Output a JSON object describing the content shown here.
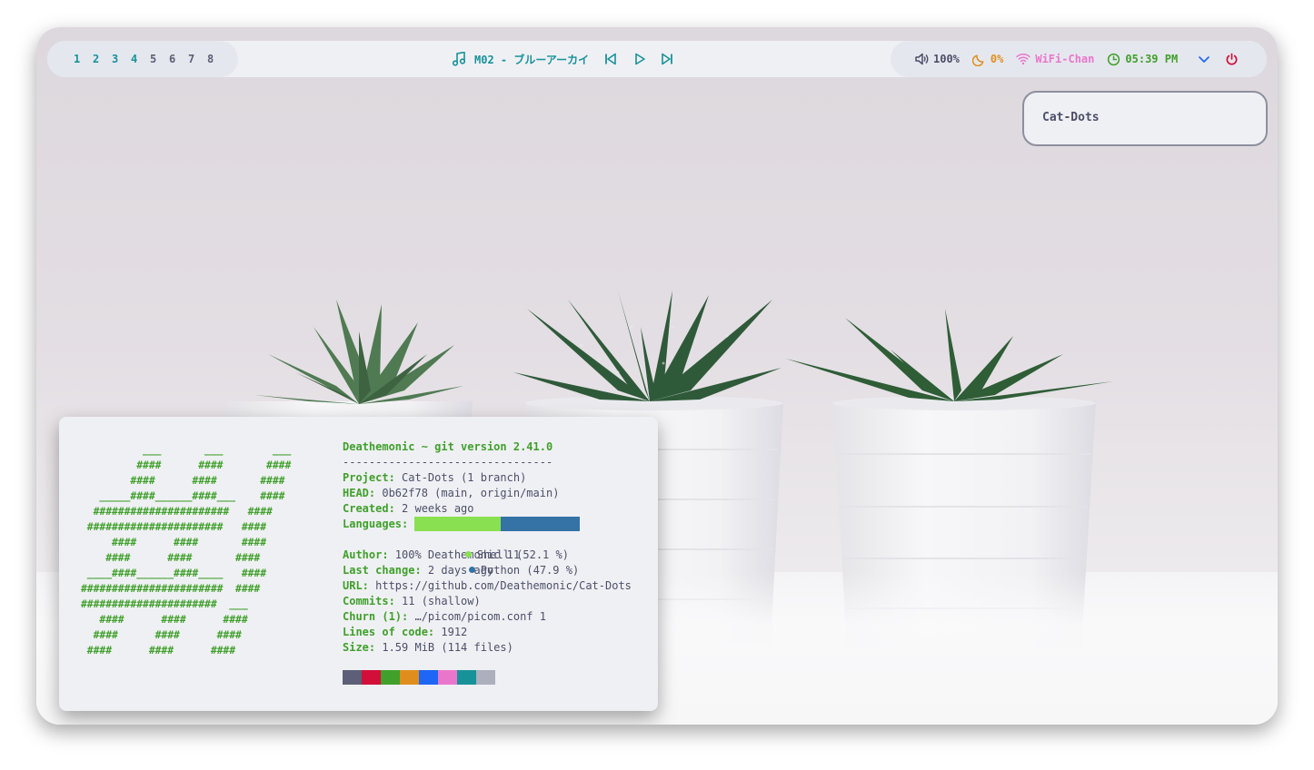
{
  "workspaces": {
    "items": [
      "1",
      "2",
      "3",
      "4",
      "5",
      "6",
      "7",
      "8"
    ],
    "active": [
      0,
      1,
      2,
      3
    ]
  },
  "media": {
    "title": "M02 - ブルーアーカイ",
    "note_icon": "music-note-icon",
    "prev_icon": "skip-back-icon",
    "play_icon": "play-icon",
    "next_icon": "skip-forward-icon",
    "color": "#179299"
  },
  "status": {
    "volume": {
      "icon": "volume-icon",
      "value": "100%",
      "color": "#4c4f69"
    },
    "brightness": {
      "icon": "moon-icon",
      "value": "0%",
      "color": "#df8e1d"
    },
    "wifi": {
      "icon": "wifi-icon",
      "value": "WiFi-Chan",
      "color": "#ea76cb"
    },
    "clock": {
      "icon": "clock-icon",
      "value": "05:39 PM",
      "color": "#40a02b"
    },
    "tray_icon": "chevron-down-icon",
    "power_icon": "power-icon",
    "power_color": "#d20f39"
  },
  "notification": {
    "text": "Cat-Dots"
  },
  "terminal": {
    "ascii": [
      "          ___       ___        ___",
      "         ####      ####       ####",
      "        ####      ####       ####",
      "   _____####______####___    ####",
      "  ######################   ####",
      " ######################   ####",
      "     ####      ####       ####",
      "    ####      ####       ####",
      " ____####______####____   ####",
      "#######################  ####",
      "######################  ___",
      "   ####      ####      ####",
      "  ####      ####      ####",
      " ####      ####      ####"
    ],
    "header": "Deathemonic ~ git version 2.41.0",
    "separator": "--------------------------------",
    "rows": [
      {
        "key": "Project:",
        "value": " Cat-Dots (1 branch)"
      },
      {
        "key": "HEAD:",
        "value": " 0b62f78 (main, origin/main)"
      },
      {
        "key": "Created:",
        "value": " 2 weeks ago"
      }
    ],
    "languages_label": "Languages:",
    "languages": [
      {
        "name": "Shell (52.1 %)",
        "share": 52.1,
        "color": "#89e051"
      },
      {
        "name": "Python (47.9 %)",
        "share": 47.9,
        "color": "#3572a5"
      }
    ],
    "rows2": [
      {
        "key": "Author:",
        "value": " 100% Deathemonic 11"
      },
      {
        "key": "Last change:",
        "value": " 2 days ago"
      },
      {
        "key": "URL:",
        "value": " https://github.com/Deathemonic/Cat-Dots"
      },
      {
        "key": "Commits:",
        "value": " 11 (shallow)"
      },
      {
        "key": "Churn (1):",
        "value": " …/picom/picom.conf 1"
      },
      {
        "key": "Lines of code:",
        "value": " 1912"
      },
      {
        "key": "Size:",
        "value": " 1.59 MiB (114 files)"
      }
    ],
    "palette": [
      "#5c5f77",
      "#d20f39",
      "#40a02b",
      "#df8e1d",
      "#1e66f5",
      "#ea76cb",
      "#179299",
      "#acb0be"
    ]
  }
}
